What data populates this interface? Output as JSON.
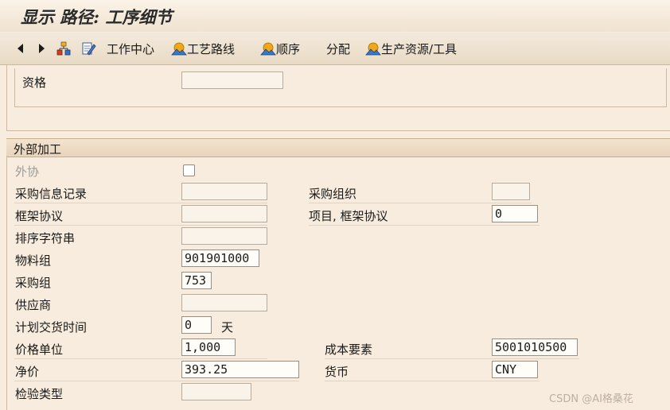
{
  "title": "显示 路径: 工序细节",
  "toolbar": {
    "work_center": "工作中心",
    "routing": "工艺路线",
    "sequence": "顺序",
    "allocation": "分配",
    "prt": "生产资源/工具"
  },
  "upper": {
    "qualification_label": "资格",
    "qualification_value": ""
  },
  "external": {
    "section_title": "外部加工",
    "subcontracting_label": "外协",
    "subcontracting_checked": false,
    "rows": [
      {
        "label": "采购信息记录",
        "value": ""
      },
      {
        "label": "框架协议",
        "value": ""
      },
      {
        "label": "排序字符串",
        "value": ""
      },
      {
        "label": "物料组",
        "value": "901901000"
      },
      {
        "label": "采购组",
        "value": "753"
      },
      {
        "label": "供应商",
        "value": ""
      },
      {
        "label": "计划交货时间",
        "value": "0",
        "unit": "天"
      },
      {
        "label": "价格单位",
        "value": "1,000"
      },
      {
        "label": "净价",
        "value": "393.25"
      },
      {
        "label": "检验类型",
        "value": ""
      }
    ],
    "right": [
      {
        "label": "采购组织",
        "value": ""
      },
      {
        "label": "项目, 框架协议",
        "value": "0"
      },
      {
        "label": "成本要素",
        "value": "5001010500"
      },
      {
        "label": "货币",
        "value": "CNY"
      }
    ]
  },
  "watermark": "CSDN @AI格桑花"
}
